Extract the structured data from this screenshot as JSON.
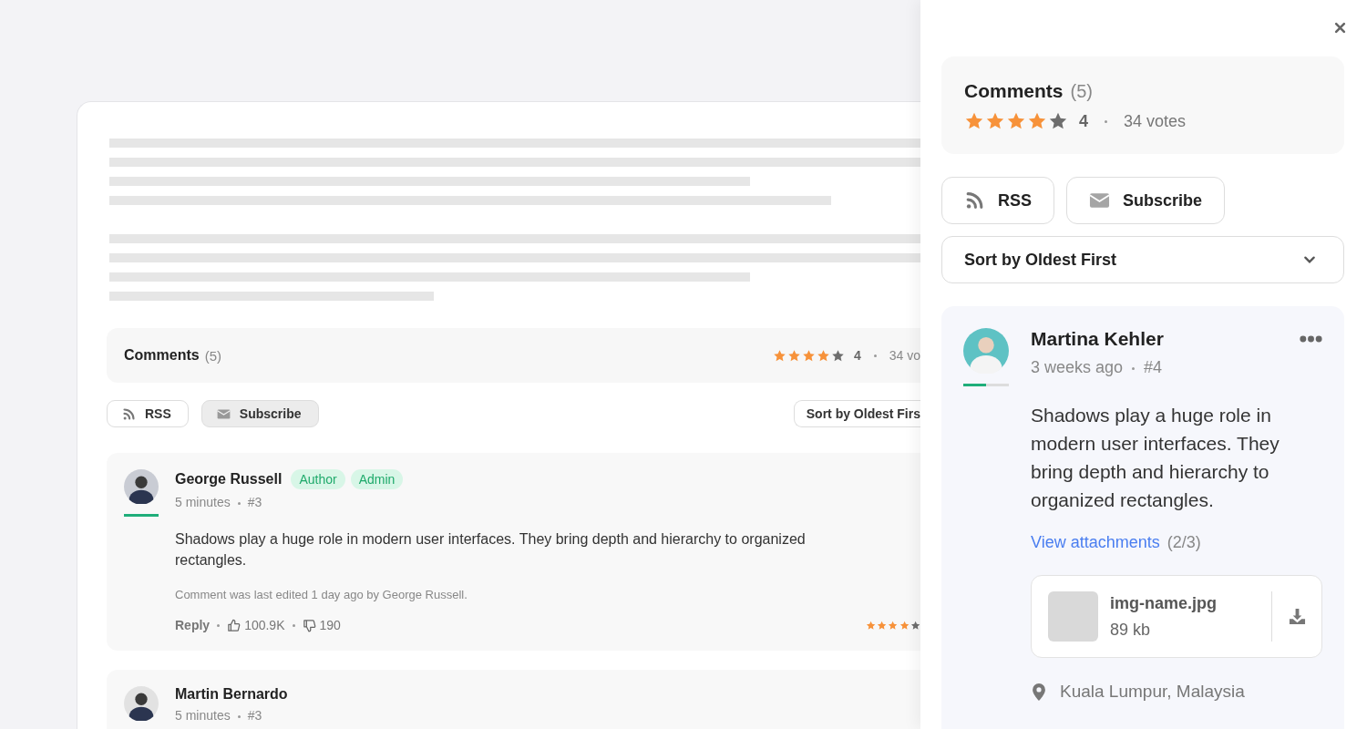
{
  "page": {
    "summary": {
      "title": "Comments",
      "count": "(5)",
      "stars": 4,
      "rating": "4",
      "votes": "34 vo"
    },
    "actions": [
      {
        "label": "RSS",
        "kind": "rss",
        "active": false
      },
      {
        "label": "Subscribe",
        "kind": "mail",
        "active": true
      }
    ],
    "sort": {
      "value": "Sort by Oldest Firs"
    },
    "comments": [
      {
        "author": "George Russell",
        "badges": [
          "Author",
          "Admin"
        ],
        "time": "5 minutes",
        "number": "#3",
        "level": 1,
        "text": "Shadows play a huge role in modern user interfaces. They bring depth and hierarchy to organized rectangles.",
        "edited": "Comment was last edited 1 day ago by George Russell.",
        "reply": "Reply",
        "likes": "100.9K",
        "dislikes": "190",
        "stars": 4
      },
      {
        "author": "Martin Bernardo",
        "time": "5 minutes",
        "number": "#3"
      }
    ]
  },
  "drawer": {
    "summary": {
      "title": "Comments",
      "count": "(5)",
      "stars": 4,
      "rating": "4",
      "votes": "34 votes"
    },
    "actions": [
      {
        "label": "RSS",
        "kind": "rss",
        "active": false
      },
      {
        "label": "Subscribe",
        "kind": "mail",
        "active": false
      }
    ],
    "sort": {
      "value": "Sort by Oldest First"
    },
    "comment": {
      "author": "Martina Kehler",
      "time": "3 weeks ago",
      "number": "#4",
      "level": 0.5,
      "text": "Shadows play a huge role in modern user interfaces. They bring depth and hierarchy to organized rectangles.",
      "link": "View attachments",
      "link_count": "(2/3)",
      "attachment": {
        "name": "img-name.jpg",
        "size": "89 kb"
      },
      "location": "Kuala Lumpur, Malaysia"
    }
  }
}
